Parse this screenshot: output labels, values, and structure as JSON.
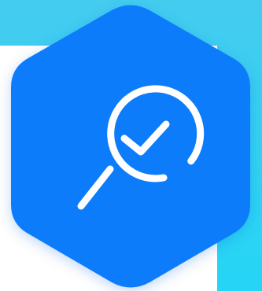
{
  "badge": {
    "icon": "search-check-icon",
    "colors": {
      "cyan_top": "#44ccef",
      "cyan_bottom": "#2ad3f4",
      "hex_blue": "#0b7cfb",
      "hex_blue_dark": "#0a6ff0",
      "icon_stroke": "#ffffff",
      "background": "#ffffff"
    }
  }
}
